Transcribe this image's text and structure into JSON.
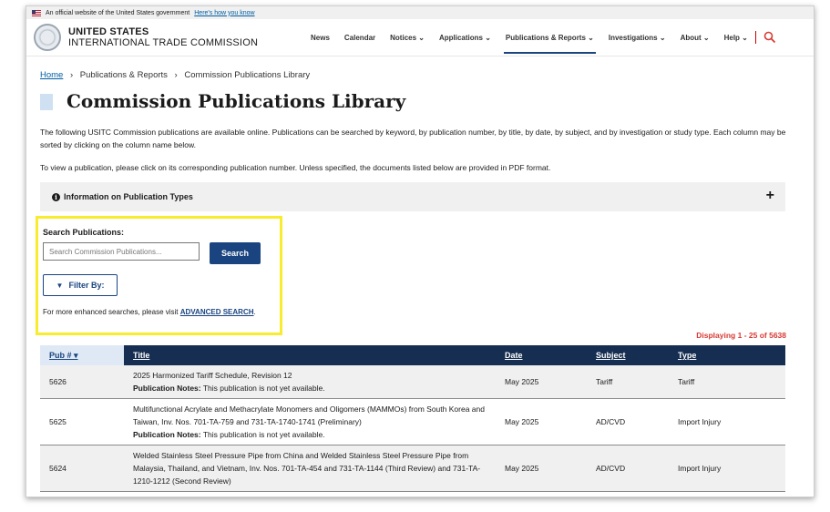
{
  "gov_banner": {
    "text": "An official website of the United States government",
    "link": "Here's how you know"
  },
  "brand": {
    "line1": "UNITED STATES",
    "line2": "INTERNATIONAL TRADE COMMISSION"
  },
  "nav": [
    {
      "label": "News"
    },
    {
      "label": "Calendar"
    },
    {
      "label": "Notices ⌄"
    },
    {
      "label": "Applications ⌄"
    },
    {
      "label": "Publications & Reports ⌄"
    },
    {
      "label": "Investigations ⌄"
    },
    {
      "label": "About ⌄"
    },
    {
      "label": "Help ⌄"
    }
  ],
  "breadcrumb": {
    "home": "Home",
    "sep": "›",
    "level2": "Publications & Reports",
    "level3": "Commission Publications Library"
  },
  "page_title": "Commission Publications Library",
  "intro": "The following USITC Commission publications are available online. Publications can be searched by keyword, by publication number, by title, by date, by subject, and by investigation or study type. Each column may be sorted by clicking on the column name below.",
  "instructions": "To view a publication, please click on its corresponding publication number. Unless specified, the documents listed below are provided in PDF format.",
  "accordion": {
    "label": "Information on Publication Types",
    "toggle": "+"
  },
  "search": {
    "label": "Search Publications:",
    "placeholder": "Search Commission Publications...",
    "button": "Search",
    "filter": "Filter By:",
    "more_text": "For more enhanced searches, please visit ",
    "advanced": "ADVANCED SEARCH",
    "period": "."
  },
  "displaying": "Displaying 1 - 25 of 5638",
  "table": {
    "headers": {
      "pub": "Pub # ▾",
      "title": "Title",
      "date": "Date",
      "subject": "Subject",
      "type": "Type"
    },
    "notes_label": "Publication Notes:",
    "rows": [
      {
        "pub": "5626",
        "title": "2025 Harmonized Tariff Schedule, Revision 12",
        "notes": " This publication is not yet available.",
        "date": "May 2025",
        "subject": "Tariff",
        "type": "Tariff"
      },
      {
        "pub": "5625",
        "title": "Multifunctional Acrylate and Methacrylate Monomers and Oligomers (MAMMOs) from South Korea and Taiwan, Inv. Nos. 701-TA-759 and 731-TA-1740-1741 (Preliminary)",
        "notes": " This publication is not yet available.",
        "date": "May 2025",
        "subject": "AD/CVD",
        "type": "Import Injury"
      },
      {
        "pub": "5624",
        "title": "Welded Stainless Steel Pressure Pipe from China and Welded Stainless Steel Pressure Pipe from Malaysia, Thailand, and Vietnam, Inv. Nos. 701-TA-454 and 731-TA-1144 (Third Review) and 731-TA-1210-1212 (Second Review)",
        "notes": "",
        "date": "May 2025",
        "subject": "AD/CVD",
        "type": "Import Injury"
      }
    ]
  }
}
